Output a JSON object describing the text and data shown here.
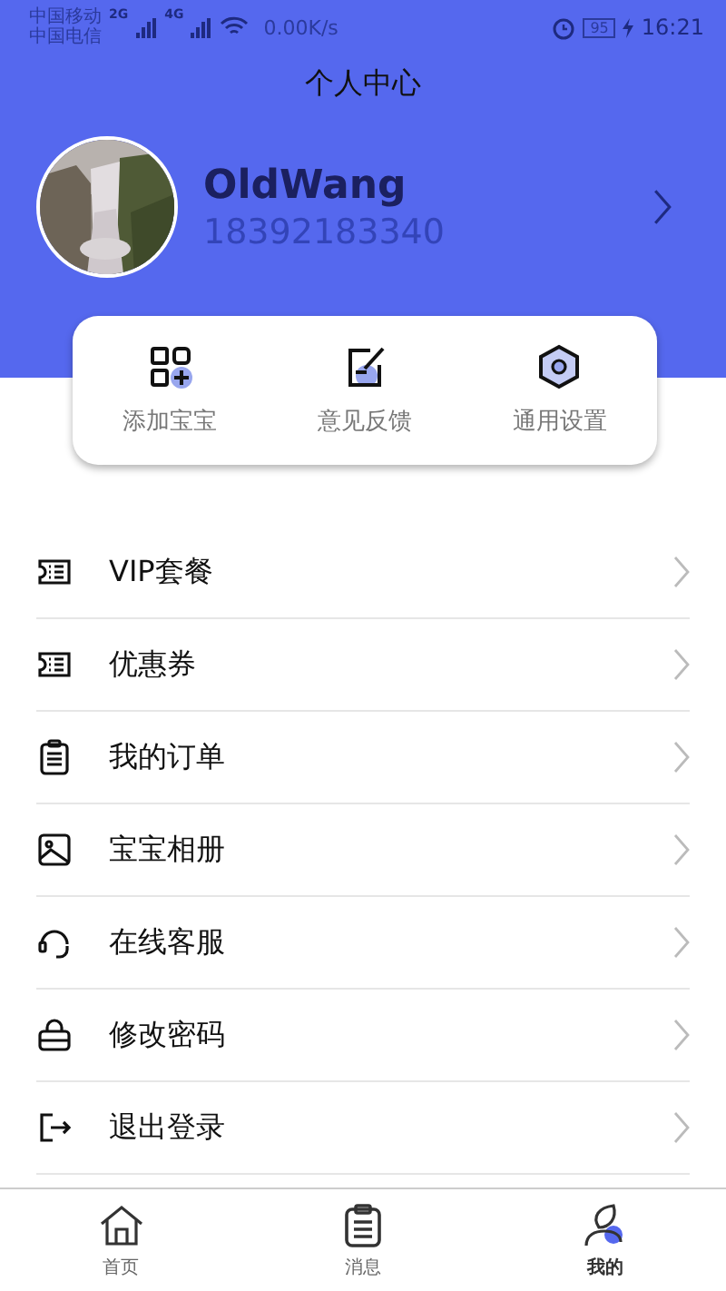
{
  "status_bar": {
    "carriers": [
      "中国移动",
      "中国电信"
    ],
    "signals": [
      "2G",
      "4G"
    ],
    "speed": "0.00K/s",
    "battery": "95",
    "time": "16:21"
  },
  "header": {
    "title": "个人中心"
  },
  "profile": {
    "name": "OldWang",
    "phone": "18392183340"
  },
  "shortcuts": [
    {
      "kind": "add",
      "label": "添加宝宝"
    },
    {
      "kind": "feedback",
      "label": "意见反馈"
    },
    {
      "kind": "settings",
      "label": "通用设置"
    }
  ],
  "menu": [
    {
      "kind": "ticket",
      "label": "VIP套餐"
    },
    {
      "kind": "ticket",
      "label": "优惠券"
    },
    {
      "kind": "orders",
      "label": "我的订单"
    },
    {
      "kind": "album",
      "label": "宝宝相册"
    },
    {
      "kind": "service",
      "label": "在线客服"
    },
    {
      "kind": "lock",
      "label": "修改密码"
    },
    {
      "kind": "logout",
      "label": "退出登录"
    }
  ],
  "tab_bar": [
    {
      "kind": "home",
      "label": "首页",
      "selected": false
    },
    {
      "kind": "messages",
      "label": "消息",
      "selected": false
    },
    {
      "kind": "me",
      "label": "我的",
      "selected": true
    }
  ]
}
